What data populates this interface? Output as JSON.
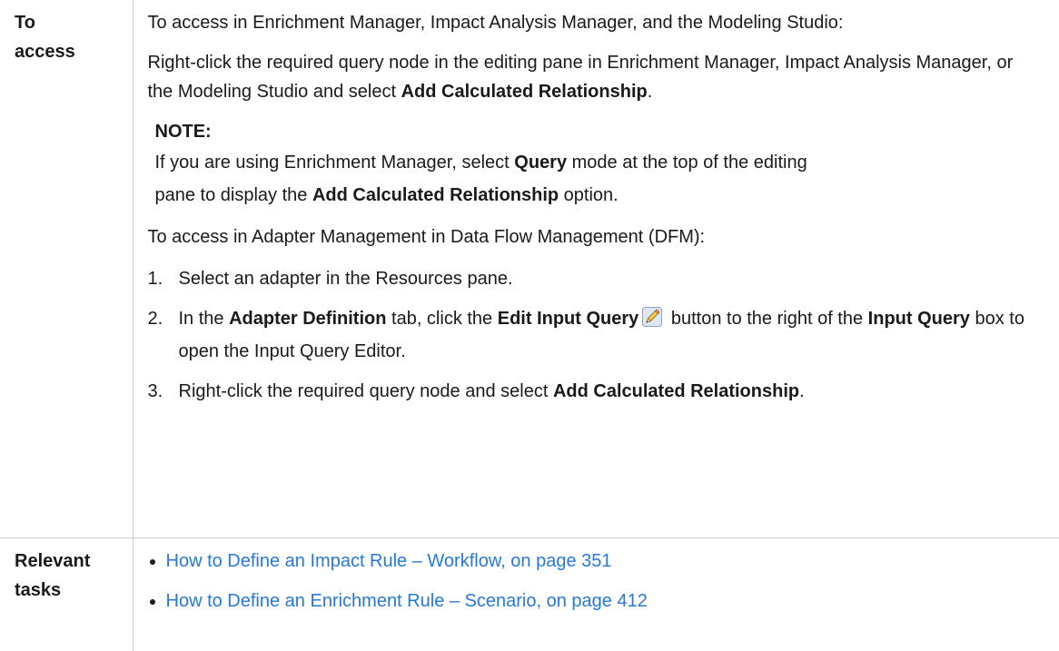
{
  "row_access": {
    "header": [
      "To",
      "access"
    ],
    "intro": "To access in Enrichment Manager, Impact Analysis Manager, and the Modeling Studio:",
    "para2": {
      "text": "Right-click the required query node in the editing pane in Enrichment Manager, Impact Analysis Manager, or the Modeling Studio and select ",
      "bold": "Add Calculated Relationship",
      "tail": "."
    },
    "note": {
      "heading": "NOTE:",
      "p1": "If you are using Enrichment Manager, select ",
      "b1": "Query",
      "p2": " mode at the top of the editing pane to display the ",
      "b2": "Add Calculated Relationship",
      "p3": " option."
    },
    "dfm_intro": "To access in Adapter Management in Data Flow Management (DFM):",
    "steps": [
      {
        "num": "1.",
        "text": "Select an adapter in the Resources pane."
      },
      {
        "num": "2.",
        "t1": "In the ",
        "b1": "Adapter Definition",
        "t2": " tab, click the ",
        "b2": "Edit Input Query",
        "t3": " button to the right of the ",
        "b3": "Input Query",
        "t4": " box to open the Input Query Editor."
      },
      {
        "num": "3.",
        "t1": "Right-click the required query node and select ",
        "b1": "Add Calculated Relationship",
        "t2": "."
      }
    ]
  },
  "row_tasks": {
    "header": [
      "Relevant",
      "tasks"
    ],
    "links": [
      "How to Define an Impact Rule – Workflow, on page 351",
      "How to Define an Enrichment Rule – Scenario, on page 412"
    ]
  },
  "colors": {
    "link": "#2778d8",
    "border": "#c9c9c9"
  }
}
